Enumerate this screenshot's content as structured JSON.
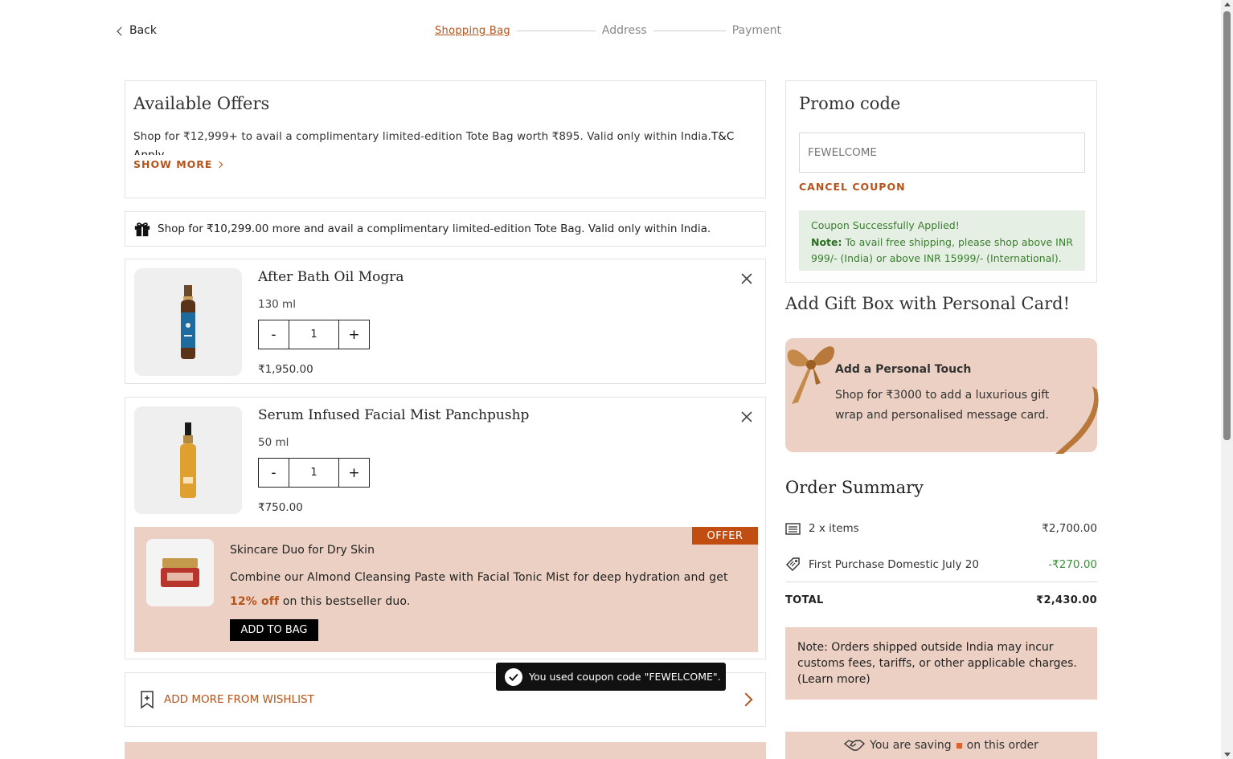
{
  "nav": {
    "back_label": "Back",
    "steps": [
      "Shopping Bag",
      "Address",
      "Payment"
    ]
  },
  "offers": {
    "title": "Available Offers",
    "text": "Shop for ₹12,999+ to avail a complimentary limited-edition Tote Bag worth ₹895. Valid only within India.",
    "tnc": "T&C Apply.",
    "show_more": "SHOW MORE"
  },
  "tote_strip": {
    "icon": "gift-icon",
    "text": "Shop for ₹10,299.00 more and avail a complimentary limited-edition Tote Bag. Valid only within India."
  },
  "cart": {
    "items": [
      {
        "name": "After Bath Oil Mogra",
        "size": "130 ml",
        "qty": "1",
        "price": "₹1,950.00",
        "bottle_color": "#1e6b9e"
      },
      {
        "name": "Serum Infused Facial Mist Panchpushp",
        "size": "50 ml",
        "qty": "1",
        "price": "₹750.00",
        "bottle_color": "#e0a030"
      }
    ],
    "minus": "-",
    "plus": "+"
  },
  "offer": {
    "tag": "OFFER",
    "title": "Skincare Duo for Dry Skin",
    "desc_a": "Combine our Almond Cleansing Paste with Facial Tonic Mist for deep hydration and get",
    "pct": "12% off",
    "desc_b": "on this bestseller duo.",
    "button": "ADD TO BAG"
  },
  "wishlist": {
    "label": "ADD MORE FROM WISHLIST"
  },
  "toast": {
    "text": "You used coupon code \"FEWELCOME\"."
  },
  "promo": {
    "title": "Promo code",
    "code": "FEWELCOME",
    "cancel": "CANCEL COUPON",
    "success": "Coupon Successfully Applied!",
    "note_label": "Note:",
    "note_text": "To avail free shipping, please shop above INR 999/- (India) or above INR 15999/- (International)."
  },
  "gift": {
    "heading": "Add Gift Box with Personal Card!",
    "title": "Add a Personal Touch",
    "desc": "Shop for ₹3000 to add a luxurious gift wrap and personalised message card."
  },
  "summary": {
    "heading": "Order Summary",
    "items_label": "2 x items",
    "items_value": "₹2,700.00",
    "discount_label": "First Purchase Domestic July 20",
    "discount_value": "-₹270.00",
    "total_label": "TOTAL",
    "total_value": "₹2,430.00"
  },
  "note": {
    "text": "Note:  Orders shipped outside India may incur customs fees, tariffs, or other applicable charges. (Learn more)"
  },
  "saving": {
    "before": "You are saving",
    "after": "on this order"
  },
  "colors": {
    "accent": "#b5531a",
    "peach": "#ebd0c3",
    "success_bg": "#e5efe4",
    "offer_tag": "#c24d10"
  }
}
